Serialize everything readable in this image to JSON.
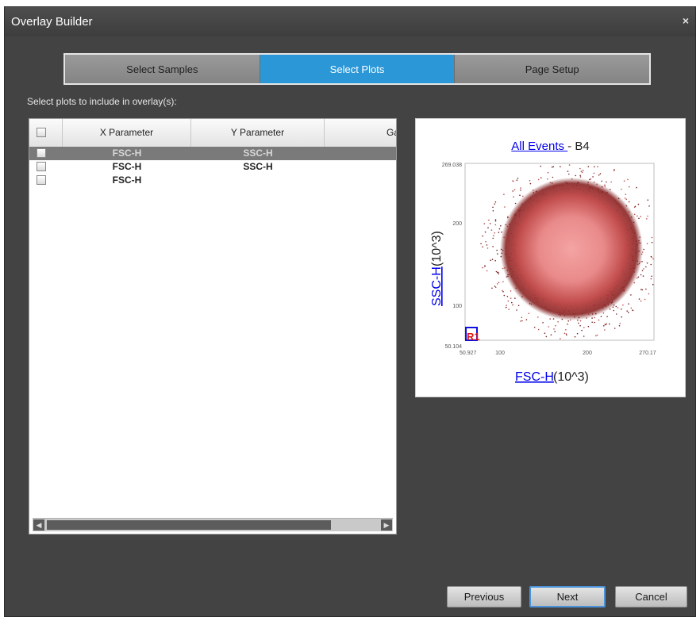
{
  "window": {
    "title": "Overlay Builder",
    "close_glyph": "×"
  },
  "tabs": [
    {
      "label": "Select Samples",
      "active": false
    },
    {
      "label": "Select Plots",
      "active": true
    },
    {
      "label": "Page Setup",
      "active": false
    }
  ],
  "instruction": "Select plots to include in overlay(s):",
  "table": {
    "columns": [
      "X Parameter",
      "Y Parameter",
      "Ga"
    ],
    "rows": [
      {
        "x": "FSC-H",
        "y": "SSC-H",
        "selected": true
      },
      {
        "x": "FSC-H",
        "y": "SSC-H",
        "selected": false
      },
      {
        "x": "FSC-H",
        "y": "",
        "selected": false
      }
    ]
  },
  "plot": {
    "title_link": "All Events ",
    "title_suffix": "- B4",
    "x_axis_link": "FSC-H",
    "x_axis_unit": " (10^3)",
    "y_axis_link": "SSC-H",
    "y_axis_unit": " (10^3)",
    "x_ticks": [
      "50.927",
      "100",
      "200",
      "270.17"
    ],
    "y_ticks": [
      "269.038",
      "200",
      "100",
      "50.104"
    ],
    "gate_label": "R1",
    "colors": {
      "dots_dark": "#7a1e1e",
      "dots_light": "#f4a0a0",
      "gate_box": "#1010dd",
      "gate_text": "#dd1111"
    }
  },
  "buttons": {
    "previous": "Previous",
    "next": "Next",
    "cancel": "Cancel"
  },
  "icons": {
    "close": "close-icon",
    "scroll_left": "arrow-left-icon",
    "scroll_right": "arrow-right-icon"
  }
}
